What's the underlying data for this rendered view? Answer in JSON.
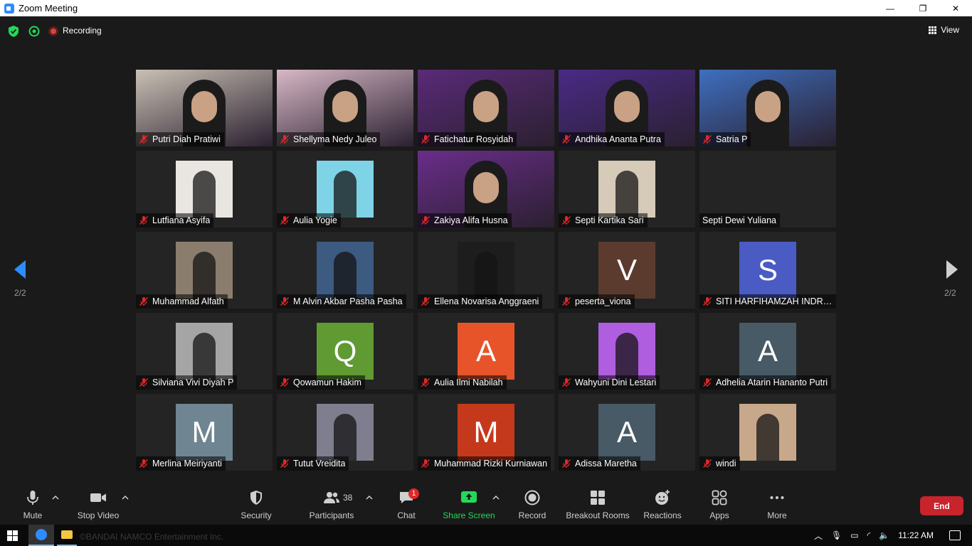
{
  "window": {
    "title": "Zoom Meeting",
    "controls": [
      "—",
      "❐",
      "✕"
    ]
  },
  "topbar": {
    "recording_label": "Recording",
    "view_label": "View"
  },
  "pager": {
    "left_page": "2/2",
    "right_page": "2/2"
  },
  "participants": [
    {
      "name": "Putri Diah Pratiwi",
      "kind": "video",
      "muted": true
    },
    {
      "name": "Shellyma Nedy Juleo",
      "kind": "video",
      "muted": true
    },
    {
      "name": "Fatichatur Rosyidah",
      "kind": "video",
      "muted": true
    },
    {
      "name": "Andhika Ananta Putra",
      "kind": "video",
      "muted": true
    },
    {
      "name": "Satria P",
      "kind": "video",
      "muted": true
    },
    {
      "name": "Lutfiana Asyifa",
      "kind": "photo",
      "muted": true
    },
    {
      "name": "Aulia Yogie",
      "kind": "photo",
      "muted": true
    },
    {
      "name": "Zakiya Alifa Husna",
      "kind": "video",
      "muted": true
    },
    {
      "name": "Septi Kartika Sari",
      "kind": "photo",
      "muted": true
    },
    {
      "name": "Septi Dewi Yuliana",
      "kind": "none",
      "muted": false
    },
    {
      "name": "Muhammad Alfath",
      "kind": "photo",
      "muted": true
    },
    {
      "name": "M Alvin Akbar Pasha Pasha",
      "kind": "photo",
      "muted": true
    },
    {
      "name": "Ellena Novarisa Anggraeni",
      "kind": "photo",
      "muted": true
    },
    {
      "name": "peserta_viona",
      "kind": "avatar",
      "initial": "V",
      "color": "#5c3b2f",
      "muted": true
    },
    {
      "name": "SITI HARFIHAMZAH INDRA ...",
      "kind": "avatar",
      "initial": "S",
      "color": "#4a5bc4",
      "muted": true
    },
    {
      "name": "Silviana Vivi Diyah P",
      "kind": "photo",
      "muted": true
    },
    {
      "name": "Qowamun Hakim",
      "kind": "avatar",
      "initial": "Q",
      "color": "#5f9a32",
      "muted": true
    },
    {
      "name": "Aulia Ilmi Nabilah",
      "kind": "avatar",
      "initial": "A",
      "color": "#e8542a",
      "muted": true
    },
    {
      "name": "Wahyuni Dini Lestari",
      "kind": "photo",
      "muted": true
    },
    {
      "name": "Adhelia Atarin Hananto Putri",
      "kind": "avatar",
      "initial": "A",
      "color": "#475a66",
      "muted": true
    },
    {
      "name": "Merlina Meiriyanti",
      "kind": "avatar",
      "initial": "M",
      "color": "#6f8591",
      "muted": true
    },
    {
      "name": "Tutut Vreidita",
      "kind": "photo",
      "muted": true
    },
    {
      "name": "Muhammad Rizki Kurniawan",
      "kind": "avatar",
      "initial": "M",
      "color": "#c4391b",
      "muted": true
    },
    {
      "name": "Adissa Maretha",
      "kind": "avatar",
      "initial": "A",
      "color": "#475a66",
      "muted": true
    },
    {
      "name": "windi",
      "kind": "photo",
      "muted": true
    }
  ],
  "toolbar": {
    "mute": "Mute",
    "stop_video": "Stop Video",
    "security": "Security",
    "participants": "Participants",
    "participant_count": "38",
    "chat": "Chat",
    "chat_badge": "1",
    "share_screen": "Share Screen",
    "record": "Record",
    "breakout_rooms": "Breakout Rooms",
    "reactions": "Reactions",
    "apps": "Apps",
    "more": "More",
    "end": "End"
  },
  "taskbar": {
    "wallpaper_text": "©BANDAI NAMCO Entertainment Inc.",
    "clock": "11:22 AM"
  },
  "colors": {
    "accent_blue": "#2d8cff",
    "share_green": "#23d959",
    "end_red": "#c8242c",
    "mute_red": "#e02828"
  }
}
